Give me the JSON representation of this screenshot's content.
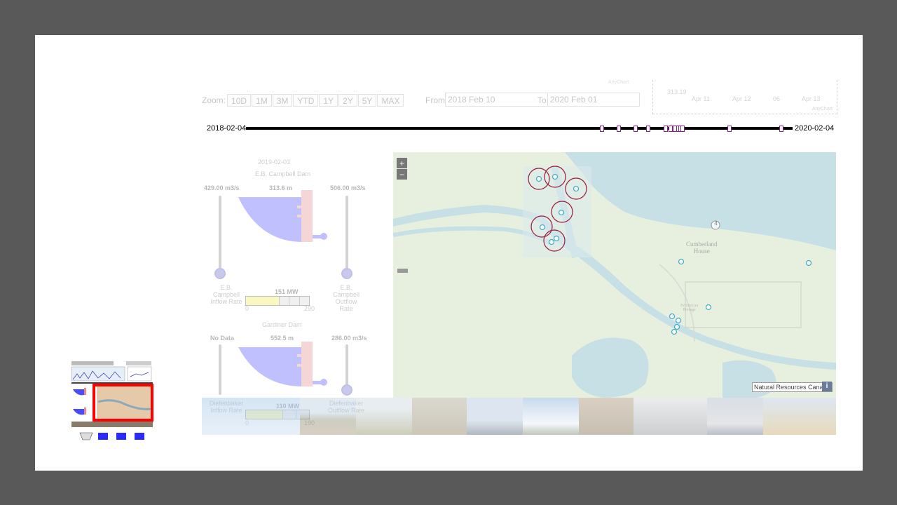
{
  "top_chart": {
    "y_value": "313.19",
    "ticks": [
      "Apr 11",
      "Apr 12",
      "06",
      "Apr 13"
    ],
    "credit": "AnyChart"
  },
  "zoom": {
    "label": "Zoom:",
    "buttons": [
      "10D",
      "1M",
      "3M",
      "YTD",
      "1Y",
      "2Y",
      "5Y",
      "MAX"
    ]
  },
  "range": {
    "from_label": "From:",
    "from_value": "2018 Feb 10",
    "to_label": "To:",
    "to_value": "2020 Feb 01"
  },
  "timeline": {
    "start": "2018-02-04",
    "end": "2020-02-04",
    "marker_fractions": [
      0.651,
      0.682,
      0.713,
      0.736,
      0.768,
      0.777,
      0.785,
      0.791,
      0.795,
      0.799,
      0.885,
      0.979
    ]
  },
  "dams": [
    {
      "date": "2019-02-03",
      "name": "E.B. Campbell Dam",
      "inflow_value": "429.00 m3/s",
      "inflow_label": "E.B.\nCampbell\nInflow Rate",
      "level": "313.6 m",
      "outflow_value": "506.00 m3/s",
      "outflow_label": "E.B.\nCampbell\nOutflow Rate",
      "power": "151 MW",
      "power_min": "0",
      "power_max": "290",
      "power_fraction": 0.52
    },
    {
      "name": "Gardiner Dam",
      "inflow_value": "No Data",
      "inflow_label": "Diefenbaker\nInflow Rate",
      "level": "552.5 m",
      "outflow_value": "286.00 m3/s",
      "outflow_label": "Diefenbaker\nOutflow Rate",
      "power": "110 MW",
      "power_min": "0",
      "power_max": "190",
      "power_fraction": 0.58
    }
  ],
  "map": {
    "zoom_in": "+",
    "zoom_out": "−",
    "place_label_1": "Cumberland",
    "place_label_2": "House",
    "route_number": "4",
    "place_label_3": "Pemmican",
    "place_label_4": "Portage",
    "attribution": "Natural Resources Canada",
    "info": "i"
  },
  "colors": {
    "background": "#595959",
    "slide": "#ffffff",
    "timeline_marker": "#8a1e8a",
    "map_water": "#a9d3ea",
    "map_land": "#eaf2e3",
    "highlight": "#ff0000"
  }
}
